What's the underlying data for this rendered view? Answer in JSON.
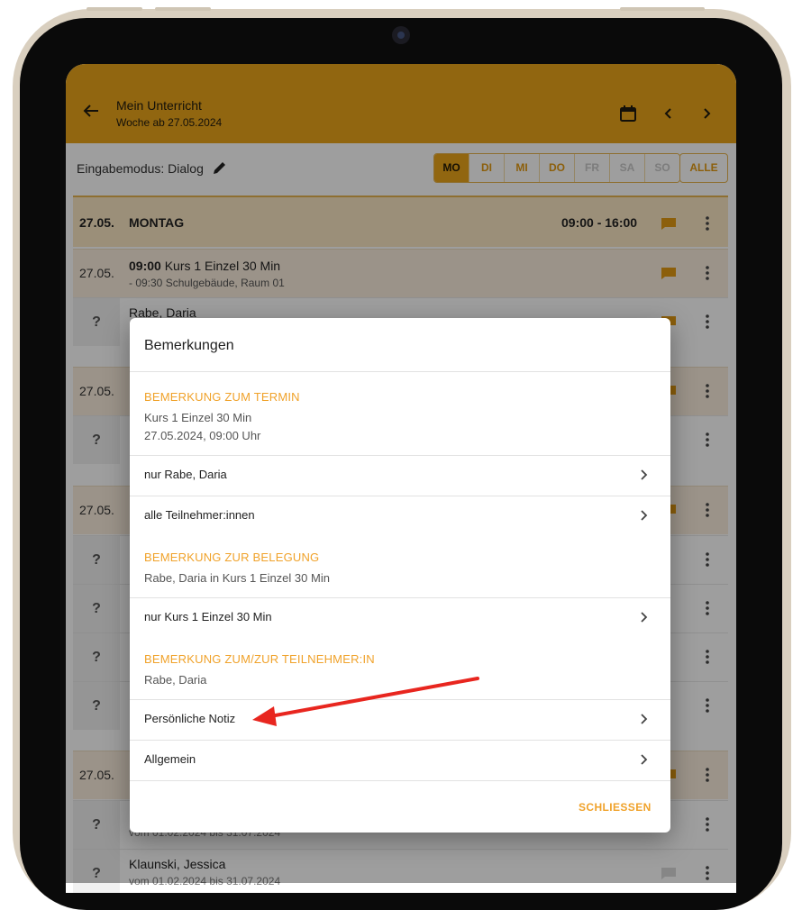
{
  "header": {
    "title": "Mein Unterricht",
    "subtitle": "Woche ab 27.05.2024"
  },
  "mode_bar": {
    "label": "Eingabemodus: Dialog",
    "days": [
      {
        "label": "MO",
        "state": "active"
      },
      {
        "label": "DI",
        "state": "normal"
      },
      {
        "label": "MI",
        "state": "normal"
      },
      {
        "label": "DO",
        "state": "normal"
      },
      {
        "label": "FR",
        "state": "disabled"
      },
      {
        "label": "SA",
        "state": "disabled"
      },
      {
        "label": "SO",
        "state": "disabled"
      }
    ],
    "all_label": "ALLE"
  },
  "schedule": {
    "day": {
      "date": "27.05.",
      "name": "MONTAG",
      "time": "09:00 - 16:00"
    },
    "course": {
      "date": "27.05.",
      "time": "09:00",
      "title": "Kurs 1 Einzel 30 Min",
      "details": "- 09:30 Schulgebäude, Raum 01"
    },
    "rows": [
      {
        "type": "person",
        "q": "?",
        "name": "Rabe, Daria",
        "sub": ""
      },
      {
        "type": "course",
        "date": "27.05."
      },
      {
        "type": "person",
        "q": "?"
      },
      {
        "type": "course",
        "date": "27.05."
      },
      {
        "type": "person",
        "q": "?"
      },
      {
        "type": "person",
        "q": "?"
      },
      {
        "type": "person",
        "q": "?"
      },
      {
        "type": "person",
        "q": "?"
      },
      {
        "type": "course",
        "date": "27.05."
      },
      {
        "type": "person",
        "q": "?",
        "name": "",
        "sub": "vom 01.02.2024 bis 31.07.2024"
      },
      {
        "type": "person",
        "q": "?",
        "name": "Klaunski, Jessica",
        "sub": "vom 01.02.2024 bis 31.07.2024"
      }
    ]
  },
  "dialog": {
    "title": "Bemerkungen",
    "sections": {
      "termin": {
        "heading": "BEMERKUNG ZUM TERMIN",
        "line1": "Kurs 1 Einzel 30 Min",
        "line2": "27.05.2024, 09:00 Uhr",
        "items": [
          "nur Rabe, Daria",
          "alle Teilnehmer:innen"
        ]
      },
      "belegung": {
        "heading": "BEMERKUNG ZUR BELEGUNG",
        "line1": "Rabe, Daria in Kurs 1 Einzel 30 Min",
        "items": [
          "nur Kurs 1 Einzel 30 Min"
        ]
      },
      "teilnehmer": {
        "heading": "BEMERKUNG ZUM/ZUR TEILNEHMER:IN",
        "line1": "Rabe, Daria",
        "items": [
          "Persönliche Notiz",
          "Allgemein"
        ]
      }
    },
    "close_label": "SCHLIESSEN"
  },
  "colors": {
    "accent": "#eba51a",
    "heading_orange": "#f0a22a",
    "annotation_arrow": "#e8261f"
  }
}
